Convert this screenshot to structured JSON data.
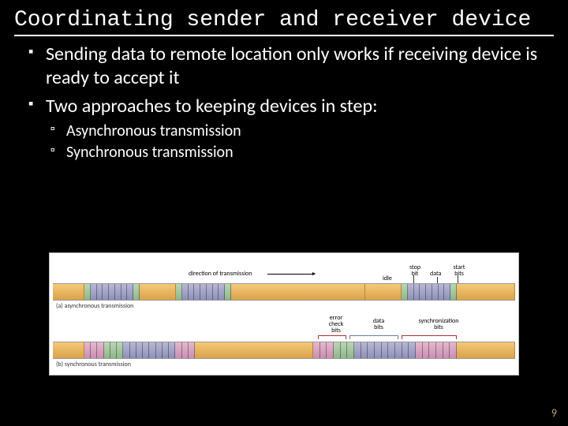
{
  "title": "Coordinating sender and receiver device",
  "bullets": {
    "b1": "Sending data to remote location only works if receiving device is ready to accept it",
    "b2": "Two approaches to keeping devices in step:",
    "b2a": "Asynchronous transmission",
    "b2b": "Synchronous transmission"
  },
  "diagram": {
    "direction_label": "direction of transmission",
    "top_labels": {
      "stop_bit": "stop\nbit",
      "data": "data",
      "start_bits": "start\nbits",
      "idle": "idle"
    },
    "caption_a": "(a)  asynchronous transmission",
    "bottom_labels": {
      "error_check_bits": "error\ncheck\nbits",
      "data_bits": "data\nbits",
      "synchronization_bits": "synchronization\nbits"
    },
    "caption_b": "(b)  synchronous transmission"
  },
  "page_number": "9"
}
